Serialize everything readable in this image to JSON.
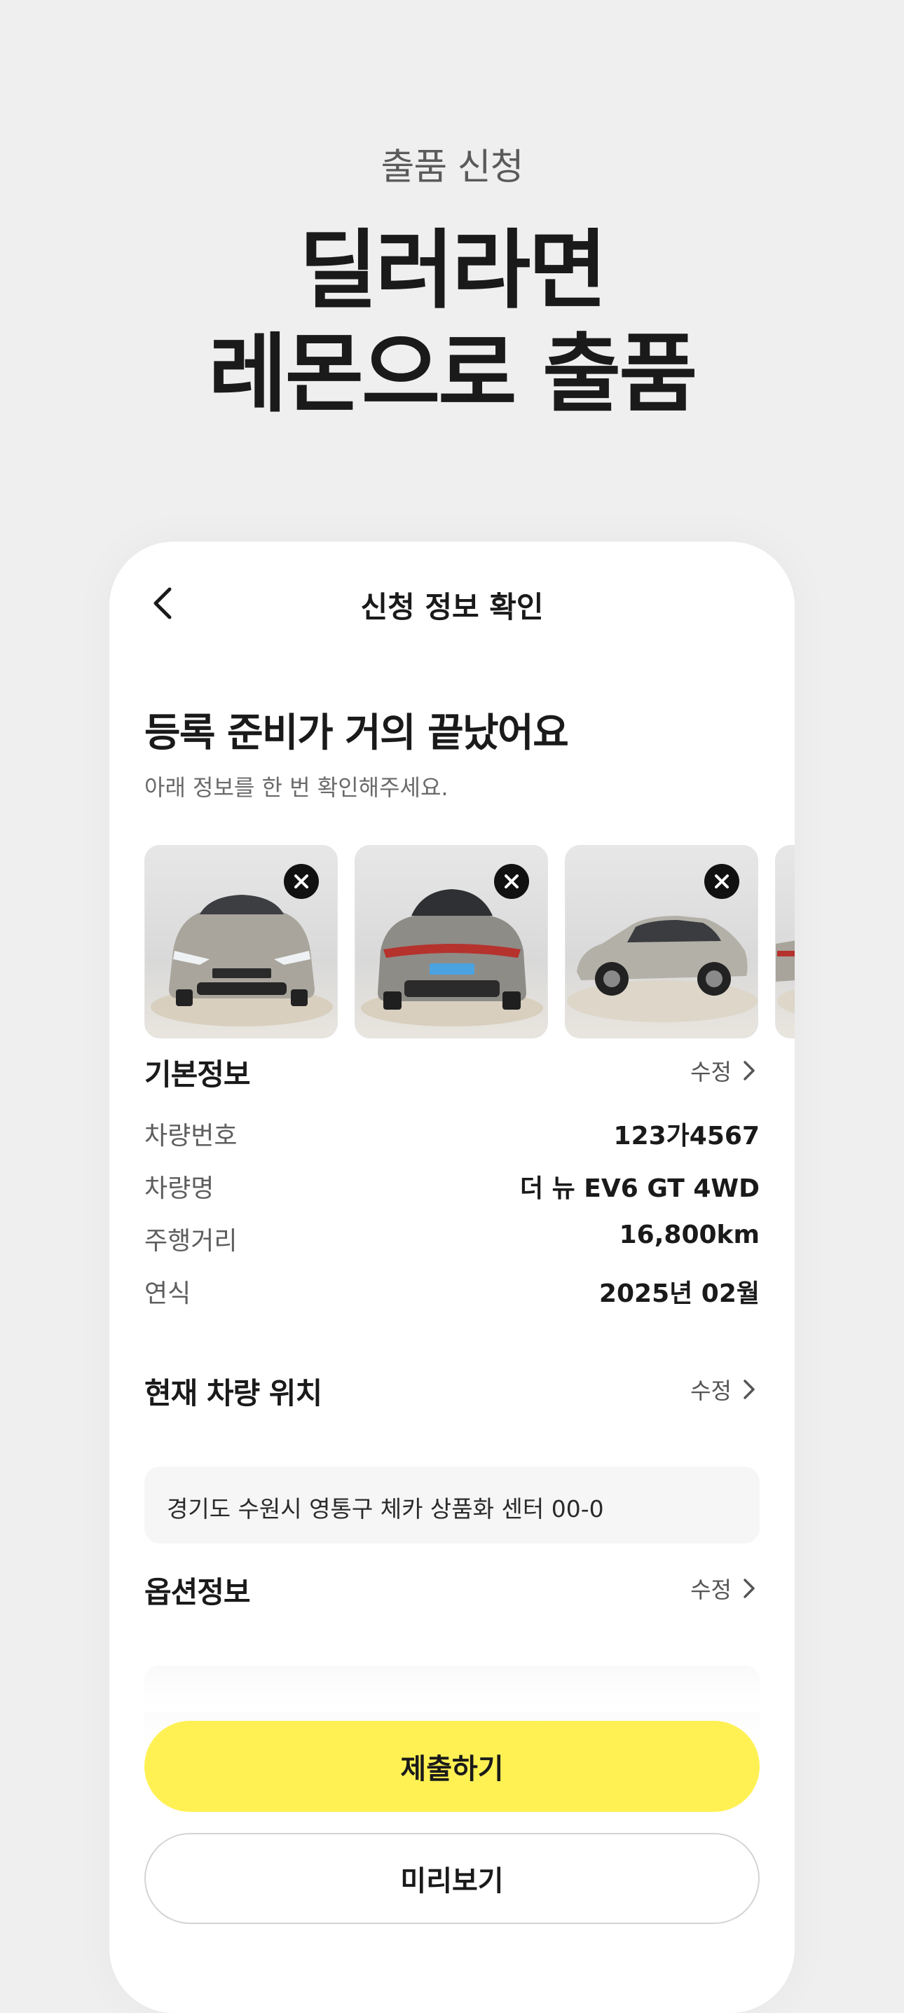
{
  "hero": {
    "subtitle": "출품 신청",
    "title_line1": "딜러라면",
    "title_line2": "레몬으로 출품"
  },
  "screen": {
    "title": "신청 정보 확인",
    "headline": "등록 준비가 거의 끝났어요",
    "subline": "아래 정보를 한 번 확인해주세요."
  },
  "photos": [
    {
      "view": "front",
      "remove_icon": "close-icon"
    },
    {
      "view": "rear",
      "remove_icon": "close-icon"
    },
    {
      "view": "side",
      "remove_icon": "close-icon"
    },
    {
      "view": "partial"
    }
  ],
  "basic_info": {
    "title": "기본정보",
    "edit_label": "수정",
    "rows": [
      {
        "label": "차량번호",
        "value": "123가4567"
      },
      {
        "label": "차량명",
        "value": "더 뉴 EV6 GT 4WD"
      },
      {
        "label": "주행거리",
        "value": "16,800km"
      },
      {
        "label": "연식",
        "value": "2025년 02월"
      }
    ]
  },
  "location": {
    "title": "현재 차량 위치",
    "edit_label": "수정",
    "address": "경기도 수원시 영통구 체카 상품화 센터 00-0"
  },
  "options": {
    "title": "옵션정보",
    "edit_label": "수정"
  },
  "buttons": {
    "submit": "제출하기",
    "preview": "미리보기"
  },
  "colors": {
    "background": "#efefef",
    "accent": "#fff153",
    "card": "#ffffff"
  }
}
